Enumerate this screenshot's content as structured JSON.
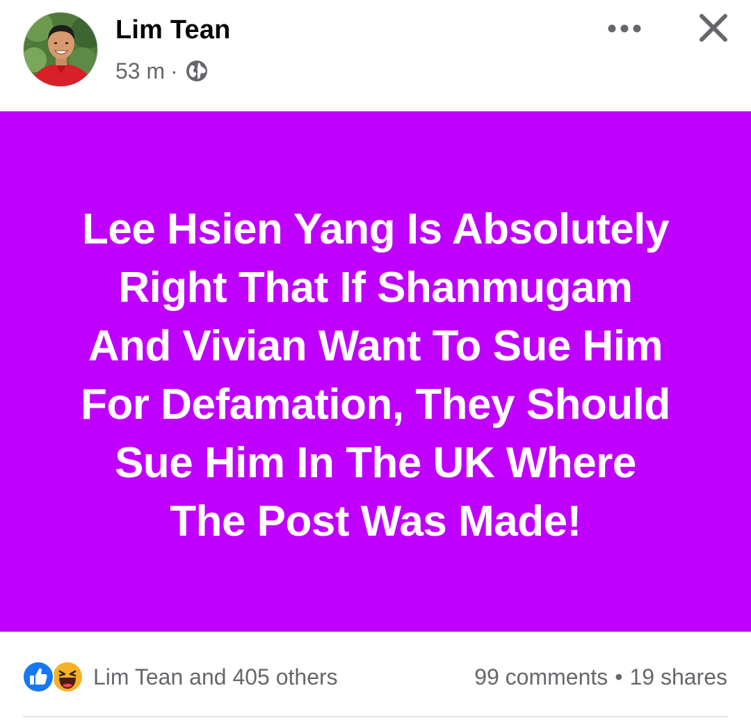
{
  "header": {
    "author_name": "Lim Tean",
    "timestamp": "53 m",
    "separator": "·",
    "privacy_icon": "globe-icon",
    "more_icon": "more-options-icon",
    "close_icon": "close-icon"
  },
  "post": {
    "background_color": "#c000ff",
    "text_color": "#ffffff",
    "lines": [
      "Lee Hsien Yang Is Absolutely",
      "Right That If Shanmugam",
      "And Vivian Want To Sue Him",
      "For Defamation, They Should",
      "Sue Him In The UK Where",
      "The Post Was Made!"
    ]
  },
  "stats": {
    "reaction_icons": [
      "like-icon",
      "haha-icon"
    ],
    "reactions_text": "Lim Tean and 405 others",
    "comments": "99 comments",
    "bullet": "•",
    "shares": "19 shares"
  },
  "colors": {
    "secondary_text": "#65676b",
    "like_blue": "#1877f2",
    "haha_yellow": "#f7b125"
  }
}
